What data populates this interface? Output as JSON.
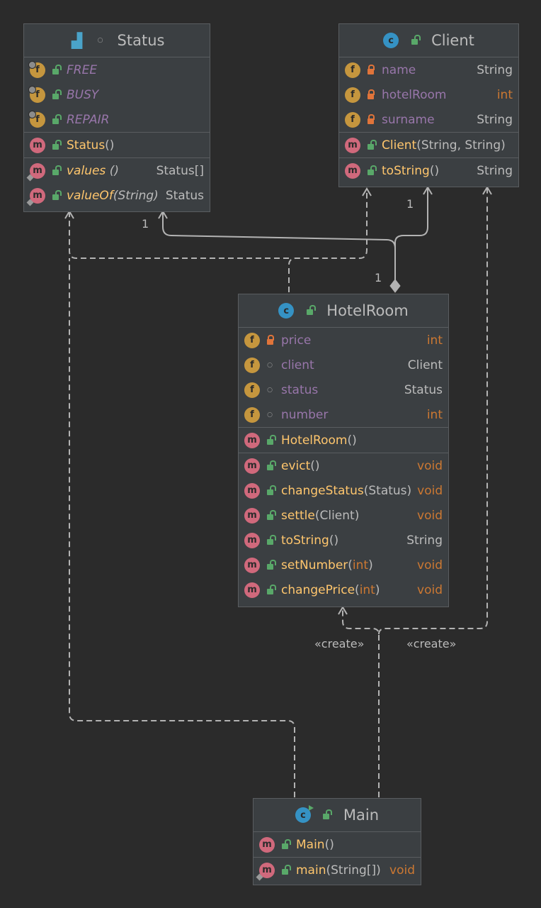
{
  "status_class": {
    "title": "Status",
    "constants": [
      "FREE",
      "BUSY",
      "REPAIR"
    ],
    "constructor": {
      "name": "Status",
      "params": "()"
    },
    "methods": [
      {
        "name": "values",
        "params": " ()",
        "type": "Status[]"
      },
      {
        "name": "valueOf",
        "params": "(String)",
        "type": "Status"
      }
    ]
  },
  "client_class": {
    "title": "Client",
    "fields": [
      {
        "name": "name",
        "type": "String"
      },
      {
        "name": "hotelRoom",
        "type": "int"
      },
      {
        "name": "surname",
        "type": "String"
      }
    ],
    "constructor": {
      "name": "Client",
      "params": "(String, String)"
    },
    "methods": [
      {
        "name": "toString",
        "params": "()",
        "type": "String"
      }
    ]
  },
  "hotelroom_class": {
    "title": "HotelRoom",
    "fields": [
      {
        "name": "price",
        "type": "int"
      },
      {
        "name": "client",
        "type": "Client"
      },
      {
        "name": "status",
        "type": "Status"
      },
      {
        "name": "number",
        "type": "int"
      }
    ],
    "constructor": {
      "name": "HotelRoom",
      "params": "()"
    },
    "methods": [
      {
        "name": "evict",
        "params": "()",
        "type": "void"
      },
      {
        "name": "changeStatus",
        "params": "(Status)",
        "type": "void"
      },
      {
        "name": "settle",
        "params": "(Client)",
        "type": "void"
      },
      {
        "name": "toString",
        "params": "()",
        "type": "String"
      },
      {
        "name": "setNumber",
        "params_open": "(",
        "param": "int",
        "params_close": ")",
        "type": "void"
      },
      {
        "name": "changePrice",
        "params_open": "(",
        "param": "int",
        "params_close": ")",
        "type": "void"
      }
    ]
  },
  "main_class": {
    "title": "Main",
    "constructor": {
      "name": "Main",
      "params": "()"
    },
    "methods": [
      {
        "name": "main",
        "params": "(String[])",
        "type": "void"
      }
    ]
  },
  "connectors": {
    "mult_status": "1",
    "mult_client": "1",
    "mult_hotelroom": "1",
    "create_left": "«create»",
    "create_right": "«create»"
  },
  "icons": {
    "field": "f",
    "method": "m",
    "class": "c",
    "enum": "enum-icon"
  },
  "colors": {
    "background": "#2b2b2b",
    "box": "#3b3f42",
    "field_name": "#9876aa",
    "method_name": "#ffc66d",
    "keyword_type": "#cc7832",
    "field_icon": "#c5963e",
    "method_icon": "#d0697c",
    "class_icon": "#3592c4"
  }
}
